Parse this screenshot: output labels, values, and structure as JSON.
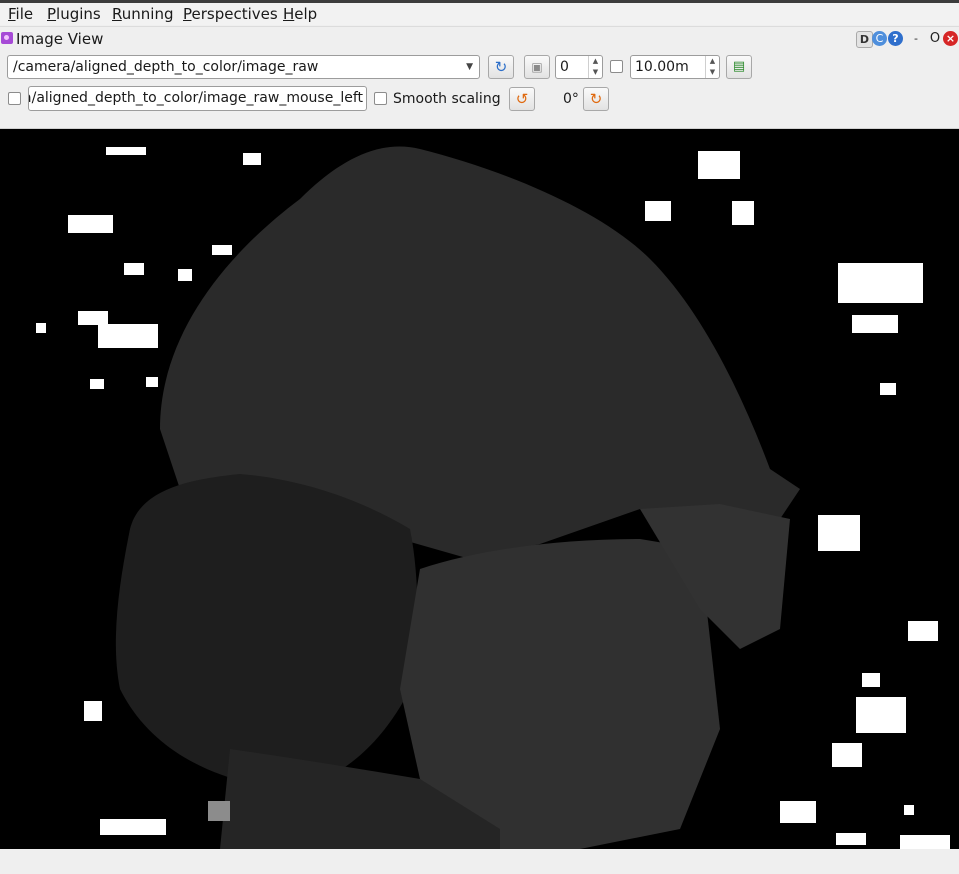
{
  "menubar": {
    "items": [
      {
        "mnemonic": "F",
        "rest": "ile"
      },
      {
        "mnemonic": "P",
        "rest": "lugins"
      },
      {
        "mnemonic": "R",
        "rest": "unning"
      },
      {
        "mnemonic": "P",
        "rest": "erspectives"
      },
      {
        "mnemonic": "H",
        "rest": "elp"
      }
    ]
  },
  "window": {
    "title": "Image View",
    "buttons": {
      "d": "D",
      "c": "C",
      "help": "?",
      "dash": "-",
      "o": "O",
      "close": "×"
    }
  },
  "toolbar": {
    "topic": "/camera/aligned_depth_to_color/image_raw",
    "min_value": "0",
    "max_value": "10.00m",
    "mouse_topic": "/camera/aligned_depth_to_color/image_raw_mouse_left",
    "smooth_label": "Smooth scaling",
    "rotation": "0°"
  },
  "icons": {
    "combo_arrow": "▼",
    "refresh": "↻",
    "save": "▣",
    "export": "▤",
    "rotate_left": "↺",
    "rotate_right": "↻",
    "spin_up": "▲",
    "spin_down": "▼"
  },
  "colors": {
    "background": "#efefef",
    "image_background": "#000000",
    "depth_near": "#262626",
    "noise": "#ffffff"
  }
}
